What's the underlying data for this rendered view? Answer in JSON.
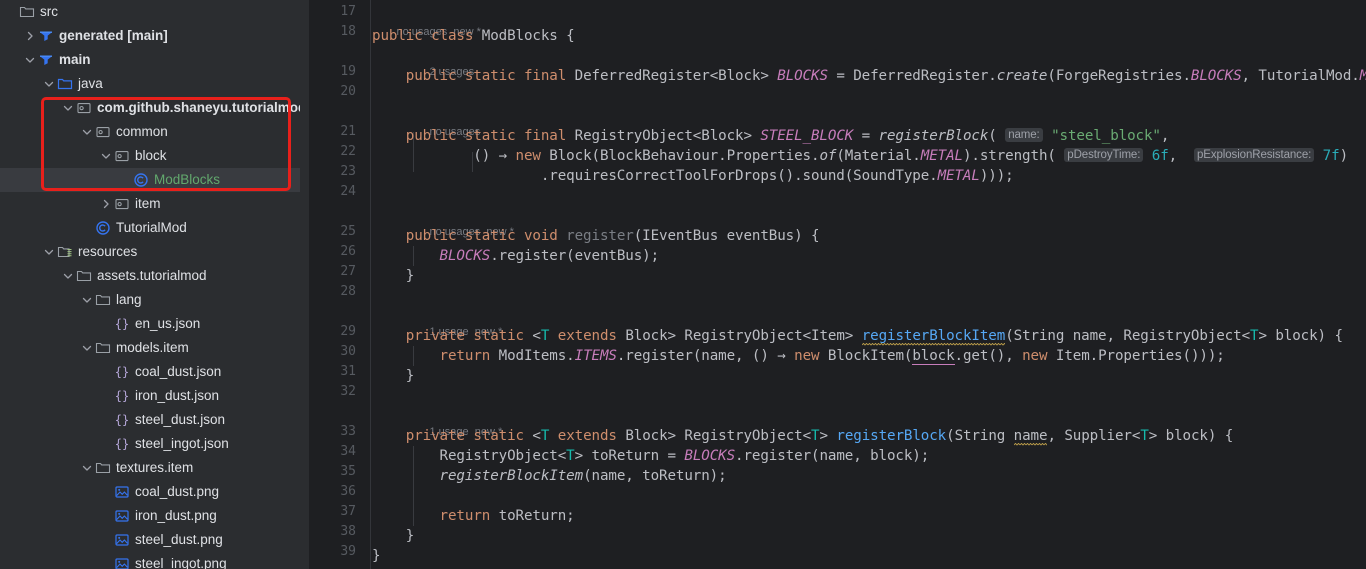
{
  "project_tree": {
    "rows": [
      {
        "indent": 0,
        "arrow": "none",
        "icon": "folder-icon",
        "label": "src",
        "bold": false,
        "green": false,
        "selected": false
      },
      {
        "indent": 1,
        "arrow": "right",
        "icon": "source-root-icon",
        "label": "generated [main]",
        "bold": true,
        "green": false,
        "selected": false
      },
      {
        "indent": 1,
        "arrow": "down",
        "icon": "source-root-icon",
        "label": "main",
        "bold": true,
        "green": false,
        "selected": false
      },
      {
        "indent": 2,
        "arrow": "down",
        "icon": "java-folder-icon",
        "label": "java",
        "bold": false,
        "green": false,
        "selected": false
      },
      {
        "indent": 3,
        "arrow": "down",
        "icon": "package-icon",
        "label": "com.github.shaneyu.tutorialmod",
        "bold": true,
        "green": false,
        "selected": false
      },
      {
        "indent": 4,
        "arrow": "down",
        "icon": "package-icon",
        "label": "common",
        "bold": false,
        "green": false,
        "selected": false
      },
      {
        "indent": 5,
        "arrow": "down",
        "icon": "package-icon",
        "label": "block",
        "bold": false,
        "green": false,
        "selected": false
      },
      {
        "indent": 6,
        "arrow": "none",
        "icon": "java-class-icon",
        "label": "ModBlocks",
        "bold": false,
        "green": true,
        "selected": true
      },
      {
        "indent": 5,
        "arrow": "right",
        "icon": "package-icon",
        "label": "item",
        "bold": false,
        "green": false,
        "selected": false
      },
      {
        "indent": 4,
        "arrow": "none",
        "icon": "java-class-icon",
        "label": "TutorialMod",
        "bold": false,
        "green": false,
        "selected": false
      },
      {
        "indent": 2,
        "arrow": "down",
        "icon": "resources-root-icon",
        "label": "resources",
        "bold": false,
        "green": false,
        "selected": false
      },
      {
        "indent": 3,
        "arrow": "down",
        "icon": "folder-icon",
        "label": "assets.tutorialmod",
        "bold": false,
        "green": false,
        "selected": false
      },
      {
        "indent": 4,
        "arrow": "down",
        "icon": "folder-icon",
        "label": "lang",
        "bold": false,
        "green": false,
        "selected": false
      },
      {
        "indent": 5,
        "arrow": "none",
        "icon": "json-file-icon",
        "label": "en_us.json",
        "bold": false,
        "green": false,
        "selected": false
      },
      {
        "indent": 4,
        "arrow": "down",
        "icon": "folder-icon",
        "label": "models.item",
        "bold": false,
        "green": false,
        "selected": false
      },
      {
        "indent": 5,
        "arrow": "none",
        "icon": "json-file-icon",
        "label": "coal_dust.json",
        "bold": false,
        "green": false,
        "selected": false
      },
      {
        "indent": 5,
        "arrow": "none",
        "icon": "json-file-icon",
        "label": "iron_dust.json",
        "bold": false,
        "green": false,
        "selected": false
      },
      {
        "indent": 5,
        "arrow": "none",
        "icon": "json-file-icon",
        "label": "steel_dust.json",
        "bold": false,
        "green": false,
        "selected": false
      },
      {
        "indent": 5,
        "arrow": "none",
        "icon": "json-file-icon",
        "label": "steel_ingot.json",
        "bold": false,
        "green": false,
        "selected": false
      },
      {
        "indent": 4,
        "arrow": "down",
        "icon": "folder-icon",
        "label": "textures.item",
        "bold": false,
        "green": false,
        "selected": false
      },
      {
        "indent": 5,
        "arrow": "none",
        "icon": "image-file-icon",
        "label": "coal_dust.png",
        "bold": false,
        "green": false,
        "selected": false
      },
      {
        "indent": 5,
        "arrow": "none",
        "icon": "image-file-icon",
        "label": "iron_dust.png",
        "bold": false,
        "green": false,
        "selected": false
      },
      {
        "indent": 5,
        "arrow": "none",
        "icon": "image-file-icon",
        "label": "steel_dust.png",
        "bold": false,
        "green": false,
        "selected": false
      },
      {
        "indent": 5,
        "arrow": "none",
        "icon": "image-file-icon",
        "label": "steel_ingot.png",
        "bold": false,
        "green": false,
        "selected": false
      }
    ],
    "annotation": {
      "shape": "rectangle",
      "color": "#e8201b"
    }
  },
  "editor": {
    "line_numbers": [
      "17",
      "18",
      "19",
      "20",
      "21",
      "22",
      "23",
      "24",
      "25",
      "26",
      "27",
      "28",
      "29",
      "30",
      "31",
      "32",
      "33",
      "34",
      "35",
      "36",
      "37",
      "38",
      "39"
    ],
    "inlay_hints": [
      {
        "line": 17,
        "usages": "no usages",
        "new": "new *"
      },
      {
        "line": 18,
        "usages": "2 usages",
        "new": ""
      },
      {
        "line": 20,
        "usages": "no usages",
        "new": ""
      },
      {
        "line": 24,
        "usages": "no usages",
        "new": "new *"
      },
      {
        "line": 28,
        "usages": "1 usage",
        "new": "new *"
      },
      {
        "line": 32,
        "usages": "1 usage",
        "new": "new *"
      }
    ],
    "parameter_hints": [
      "name:",
      "pDestroyTime:",
      "pExplosionResistance:"
    ],
    "code_lines": [
      {
        "n": "18",
        "text": "public class ModBlocks {"
      },
      {
        "n": "19",
        "text": "    public static final DeferredRegister<Block> BLOCKS = DeferredRegister.create(ForgeRegistries.BLOCKS, TutorialMod.MODID);"
      },
      {
        "n": "20",
        "text": ""
      },
      {
        "n": "21",
        "text": "    public static final RegistryObject<Block> STEEL_BLOCK = registerBlock( name: \"steel_block\","
      },
      {
        "n": "22",
        "text": "            () -> new Block(BlockBehaviour.Properties.of(Material.METAL).strength( pDestroyTime: 6f,  pExplosionResistance: 7f)"
      },
      {
        "n": "23",
        "text": "                    .requiresCorrectToolForDrops().sound(SoundType.METAL)));"
      },
      {
        "n": "24",
        "text": ""
      },
      {
        "n": "25",
        "text": "    public static void register(IEventBus eventBus) {"
      },
      {
        "n": "26",
        "text": "        BLOCKS.register(eventBus);"
      },
      {
        "n": "27",
        "text": "    }"
      },
      {
        "n": "28",
        "text": ""
      },
      {
        "n": "29",
        "text": "    private static <T extends Block> RegistryObject<Item> registerBlockItem(String name, RegistryObject<T> block) {"
      },
      {
        "n": "30",
        "text": "        return ModItems.ITEMS.register(name, () -> new BlockItem(block.get(), new Item.Properties()));"
      },
      {
        "n": "31",
        "text": "    }"
      },
      {
        "n": "32",
        "text": ""
      },
      {
        "n": "33",
        "text": "    private static <T extends Block> RegistryObject<T> registerBlock(String name, Supplier<T> block) {"
      },
      {
        "n": "34",
        "text": "        RegistryObject<T> toReturn = BLOCKS.register(name, block);"
      },
      {
        "n": "35",
        "text": "        registerBlockItem(name, toReturn);"
      },
      {
        "n": "36",
        "text": ""
      },
      {
        "n": "37",
        "text": "        return toReturn;"
      },
      {
        "n": "38",
        "text": "    }"
      },
      {
        "n": "39",
        "text": "}"
      }
    ]
  },
  "colors": {
    "sidebar_bg": "#2b2d30",
    "editor_bg": "#1e1f22",
    "selection_bg": "#393b40",
    "annotation_red": "#e8201b",
    "keyword": "#cf8e6d",
    "string": "#6aab73",
    "number": "#2aacb8",
    "static_field": "#c77dbb",
    "declaration": "#56a8f5",
    "type_param": "#16baac",
    "text": "#bcbec4",
    "class_green": "#62a86d"
  }
}
